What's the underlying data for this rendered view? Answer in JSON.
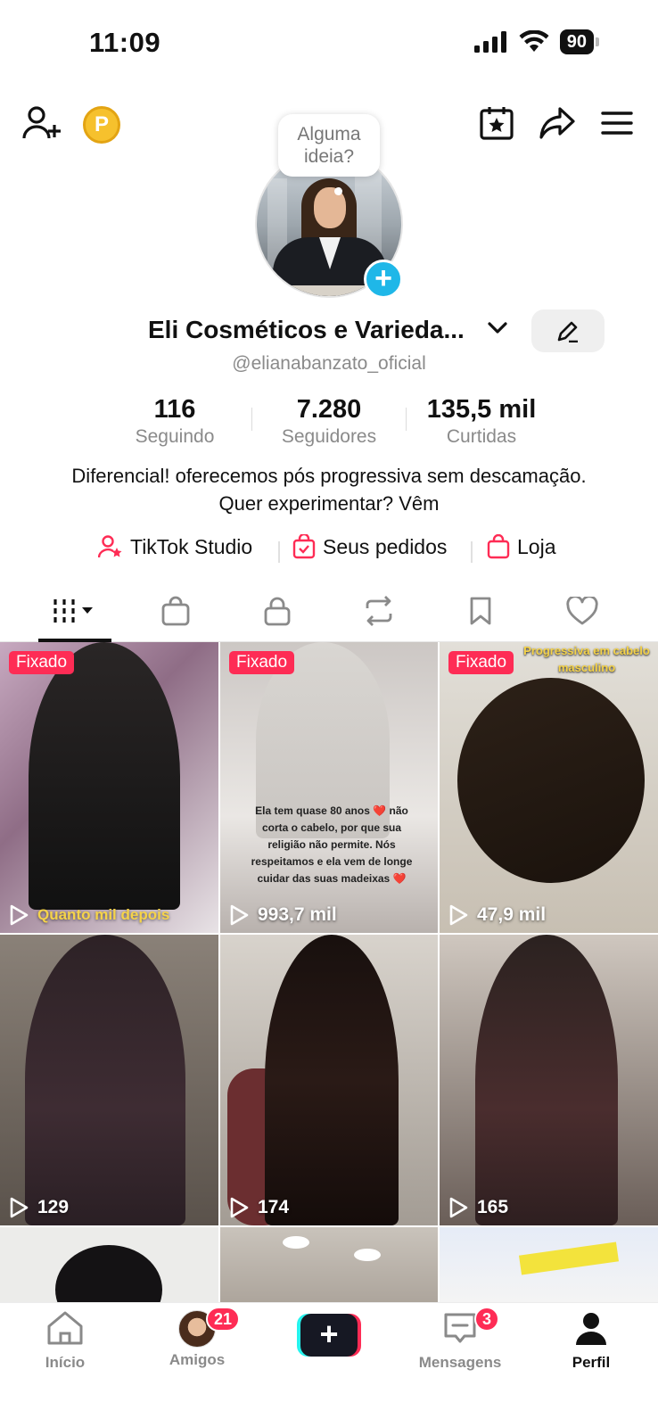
{
  "status_bar": {
    "time": "11:09",
    "battery": "90"
  },
  "profile": {
    "idea_bubble": "Alguma ideia?",
    "name": "Eli Cosméticos e Varieda...",
    "username": "@elianabanzato_oficial",
    "bio": "Diferencial! oferecemos pós progressiva sem descamação. Quer experimentar? Vêm"
  },
  "stats": [
    {
      "value": "116",
      "label": "Seguindo"
    },
    {
      "value": "7.280",
      "label": "Seguidores"
    },
    {
      "value": "135,5 mil",
      "label": "Curtidas"
    }
  ],
  "links": [
    {
      "label": "TikTok Studio",
      "icon": "user-star-icon"
    },
    {
      "label": "Seus pedidos",
      "icon": "order-bag-icon"
    },
    {
      "label": "Loja",
      "icon": "shop-bag-icon"
    }
  ],
  "tabs": [
    "videos-grid-icon",
    "shop-bag-icon",
    "lock-icon",
    "repost-icon",
    "bookmark-icon",
    "heart-icon"
  ],
  "videos": [
    {
      "pinned": "Fixado",
      "views": "",
      "caption": "Quanto mil depois"
    },
    {
      "pinned": "Fixado",
      "views": "993,7 mil",
      "caption": "Ela tem quase 80 anos ❤️ não corta o cabelo, por que sua religião não permite. Nós respeitamos e ela vem de longe cuidar das suas madeixas ❤️"
    },
    {
      "pinned": "Fixado",
      "views": "47,9 mil",
      "caption": "Progressiva em cabelo masculino"
    },
    {
      "pinned": "",
      "views": "129",
      "caption": ""
    },
    {
      "pinned": "",
      "views": "174",
      "caption": ""
    },
    {
      "pinned": "",
      "views": "165",
      "caption": ""
    }
  ],
  "bottom_nav": {
    "home": "Início",
    "friends": "Amigos",
    "friends_badge": "21",
    "create": "+",
    "inbox": "Mensagens",
    "inbox_badge": "3",
    "profile": "Perfil"
  },
  "colors": {
    "accent": "#fe2c55",
    "cyan": "#25f4ee",
    "text_secondary": "#8a8a8a"
  }
}
